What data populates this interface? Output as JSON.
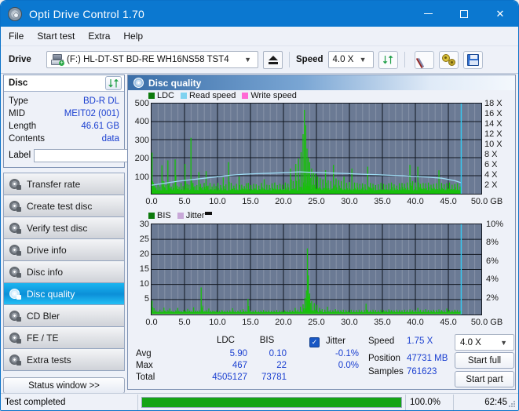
{
  "window": {
    "title": "Opti Drive Control 1.70",
    "icon": "disc-icon",
    "minimize": "–",
    "maximize": "□",
    "close": "✕"
  },
  "menu": {
    "items": [
      "File",
      "Start test",
      "Extra",
      "Help"
    ]
  },
  "toolbar": {
    "drive_label": "Drive",
    "drive_value": "(F:)  HL-DT-ST BD-RE  WH16NS58 TST4",
    "eject_title": "Eject",
    "speed_label": "Speed",
    "speed_value": "4.0 X",
    "refresh_icon": "refresh-icon",
    "erase_icon": "eraser-icon",
    "settings_icon": "gears-icon",
    "save_icon": "save-icon"
  },
  "disc_panel": {
    "title": "Disc",
    "refresh_icon": "refresh-icon",
    "rows": [
      {
        "key": "Type",
        "value": "BD-R DL"
      },
      {
        "key": "MID",
        "value": "MEIT02 (001)"
      },
      {
        "key": "Length",
        "value": "46.61 GB"
      },
      {
        "key": "Contents",
        "value": "data"
      }
    ],
    "label_key": "Label",
    "label_value": "",
    "label_button_icon": "cd-icon"
  },
  "nav": {
    "items": [
      {
        "label": "Transfer rate",
        "icon": "disc-icon",
        "active": false
      },
      {
        "label": "Create test disc",
        "icon": "disc-icon",
        "active": false
      },
      {
        "label": "Verify test disc",
        "icon": "disc-icon",
        "active": false
      },
      {
        "label": "Drive info",
        "icon": "disc-icon",
        "active": false
      },
      {
        "label": "Disc info",
        "icon": "disc-icon",
        "active": false
      },
      {
        "label": "Disc quality",
        "icon": "disc-icon",
        "active": true
      },
      {
        "label": "CD Bler",
        "icon": "disc-icon",
        "active": false
      },
      {
        "label": "FE / TE",
        "icon": "disc-icon",
        "active": false
      },
      {
        "label": "Extra tests",
        "icon": "disc-icon",
        "active": false
      }
    ],
    "status_window": "Status window >>"
  },
  "panel": {
    "title": "Disc quality",
    "icon": "disc-icon"
  },
  "stats": {
    "col_ldc": "LDC",
    "col_bis": "BIS",
    "rows": [
      {
        "label": "Avg",
        "ldc": "5.90",
        "bis": "0.10"
      },
      {
        "label": "Max",
        "ldc": "467",
        "bis": "22"
      },
      {
        "label": "Total",
        "ldc": "4505127",
        "bis": "73781"
      }
    ],
    "jitter_checked": true,
    "jitter_label": "Jitter",
    "jitter_avg": "-0.1%",
    "jitter_max": "0.0%",
    "speed_label": "Speed",
    "speed_value": "1.75 X",
    "position_label": "Position",
    "position_value": "47731 MB",
    "samples_label": "Samples",
    "samples_value": "761623",
    "speed_select": "4.0 X",
    "start_full": "Start full",
    "start_part": "Start part"
  },
  "statusbar": {
    "message": "Test completed",
    "progress_percent": 100.0,
    "progress_text": "100.0%",
    "elapsed": "62:45"
  },
  "colors": {
    "accent": "#0b78d0",
    "ldc_green": "#18c00c",
    "read_speed": "#7fd2f0",
    "write_speed": "#ff6ad5",
    "jitter": "#c8a8d8",
    "plot_bg": "#6b7a94",
    "value_blue": "#1a3fd0",
    "progress_green": "#16a416"
  },
  "chart_data": [
    {
      "id": "ldc-chart",
      "type": "area",
      "title": "",
      "xlabel": "GB",
      "ylabel": "LDC",
      "y2label": "X",
      "xlim": [
        0.0,
        50.0
      ],
      "ylim": [
        0,
        500
      ],
      "y2lim": [
        0,
        18
      ],
      "xticks": [
        0.0,
        5.0,
        10.0,
        15.0,
        20.0,
        25.0,
        30.0,
        35.0,
        40.0,
        45.0,
        50.0
      ],
      "xticklabels": [
        "0.0",
        "5.0",
        "10.0",
        "15.0",
        "20.0",
        "25.0",
        "30.0",
        "35.0",
        "40.0",
        "45.0",
        "50.0 GB"
      ],
      "yticks": [
        100,
        200,
        300,
        400,
        500
      ],
      "y2ticks": [
        2,
        4,
        6,
        8,
        10,
        12,
        14,
        16,
        18
      ],
      "y2ticklabels": [
        "2 X",
        "4 X",
        "6 X",
        "8 X",
        "10 X",
        "12 X",
        "14 X",
        "16 X",
        "18 X"
      ],
      "grid": true,
      "legend": [
        {
          "name": "LDC",
          "color": "#18c00c"
        },
        {
          "name": "Read speed",
          "color": "#7fd2f0"
        },
        {
          "name": "Write speed",
          "color": "#ff6ad5"
        }
      ],
      "legend_position": "top-left",
      "data_end_x": 46.9,
      "cursor_x": 46.95,
      "series": [
        {
          "name": "LDC",
          "kind": "spikes",
          "color": "#18c00c",
          "baseline": 18,
          "x": [
            0.0,
            0.2,
            0.4,
            0.6,
            0.9,
            1.2,
            1.5,
            1.8,
            2.1,
            2.4,
            2.6,
            2.9,
            3.2,
            3.5,
            3.8,
            4.1,
            4.4,
            4.7,
            5.0,
            5.3,
            5.6,
            5.9,
            6.2,
            6.5,
            6.8,
            7.1,
            7.35,
            7.6,
            7.9,
            8.2,
            8.5,
            8.8,
            9.1,
            9.4,
            9.7,
            10.0,
            10.4,
            10.8,
            11.2,
            11.6,
            12.0,
            12.4,
            12.8,
            13.2,
            13.6,
            14.0,
            14.3,
            14.6,
            15.0,
            15.4,
            15.8,
            16.2,
            16.6,
            17.0,
            17.4,
            17.8,
            18.2,
            18.6,
            19.0,
            19.4,
            19.8,
            20.2,
            20.6,
            21.0,
            21.4,
            21.8,
            22.2,
            22.6,
            22.9,
            23.1,
            23.3,
            23.5,
            23.7,
            23.9,
            24.2,
            24.5,
            24.8,
            25.1,
            25.5,
            25.9,
            26.3,
            26.7,
            27.1,
            27.5,
            27.9,
            28.3,
            28.7,
            29.1,
            29.5,
            29.9,
            30.3,
            30.7,
            31.1,
            31.5,
            31.9,
            32.3,
            32.7,
            33.1,
            33.5,
            33.9,
            34.3,
            34.7,
            35.1,
            35.5,
            35.9,
            36.3,
            36.7,
            37.1,
            37.5,
            37.9,
            38.3,
            38.7,
            39.1,
            39.5,
            39.9,
            40.3,
            40.7,
            41.1,
            41.5,
            41.9,
            42.3,
            42.7,
            43.1,
            43.5,
            43.9,
            44.3,
            44.7,
            45.1,
            45.5,
            45.9,
            46.3,
            46.7,
            46.9
          ],
          "y": [
            228,
            60,
            45,
            35,
            52,
            40,
            158,
            70,
            48,
            185,
            60,
            40,
            55,
            190,
            45,
            38,
            60,
            42,
            165,
            55,
            50,
            310,
            60,
            42,
            48,
            120,
            55,
            38,
            60,
            125,
            45,
            60,
            40,
            55,
            42,
            60,
            48,
            90,
            52,
            175,
            60,
            45,
            55,
            95,
            50,
            42,
            58,
            60,
            48,
            55,
            52,
            45,
            60,
            80,
            50,
            48,
            58,
            62,
            48,
            55,
            50,
            62,
            55,
            140,
            70,
            165,
            195,
            230,
            330,
            465,
            380,
            250,
            200,
            175,
            140,
            120,
            110,
            95,
            88,
            80,
            130,
            75,
            70,
            160,
            85,
            75,
            70,
            95,
            60,
            65,
            140,
            62,
            60,
            55,
            58,
            52,
            150,
            60,
            55,
            48,
            52,
            60,
            55,
            50,
            58,
            62,
            52,
            45,
            58,
            60,
            55,
            62,
            160,
            70,
            62,
            150,
            55,
            60,
            58,
            62,
            50,
            55,
            58,
            130,
            60,
            52,
            58,
            62,
            50,
            55,
            58,
            40
          ]
        },
        {
          "name": "Read speed",
          "kind": "line",
          "color": "#9fdcf5",
          "x": [
            0.0,
            2.0,
            4.0,
            6.0,
            8.0,
            10.0,
            12.0,
            14.0,
            16.0,
            18.0,
            20.0,
            21.5,
            22.5,
            23.5,
            24.5,
            26.0,
            28.0,
            30.0,
            32.0,
            34.0,
            36.0,
            38.0,
            40.0,
            42.0,
            44.0,
            46.0,
            46.9
          ],
          "y": [
            1.7,
            2.1,
            2.5,
            2.8,
            3.1,
            3.4,
            3.7,
            3.9,
            4.0,
            4.1,
            4.2,
            4.3,
            4.35,
            4.3,
            4.25,
            4.2,
            4.1,
            4.0,
            3.9,
            3.8,
            3.7,
            3.6,
            3.45,
            3.3,
            3.1,
            2.6,
            2.2
          ],
          "axis": "y2"
        }
      ]
    },
    {
      "id": "bis-chart",
      "type": "area",
      "title": "",
      "xlabel": "GB",
      "ylabel": "BIS",
      "y2label": "%",
      "xlim": [
        0.0,
        50.0
      ],
      "ylim": [
        0,
        30
      ],
      "y2lim": [
        0,
        10
      ],
      "xticks": [
        0.0,
        5.0,
        10.0,
        15.0,
        20.0,
        25.0,
        30.0,
        35.0,
        40.0,
        45.0,
        50.0
      ],
      "xticklabels": [
        "0.0",
        "5.0",
        "10.0",
        "15.0",
        "20.0",
        "25.0",
        "30.0",
        "35.0",
        "40.0",
        "45.0",
        "50.0 GB"
      ],
      "yticks": [
        5,
        10,
        15,
        20,
        25,
        30
      ],
      "y2ticks": [
        2,
        4,
        6,
        8,
        10
      ],
      "y2ticklabels": [
        "2%",
        "4%",
        "6%",
        "8%",
        "10%"
      ],
      "grid": true,
      "legend": [
        {
          "name": "BIS",
          "color": "#18c00c"
        },
        {
          "name": "Jitter",
          "color": "#c8a8d8"
        }
      ],
      "legend_position": "top-left",
      "data_end_x": 46.9,
      "cursor_x": 46.95,
      "series": [
        {
          "name": "BIS",
          "kind": "spikes",
          "color": "#18c00c",
          "baseline": 0.7,
          "x": [
            0.0,
            0.3,
            0.6,
            0.9,
            1.2,
            1.5,
            1.8,
            2.1,
            2.4,
            2.7,
            3.0,
            3.3,
            3.6,
            3.9,
            4.2,
            4.5,
            4.8,
            5.1,
            5.4,
            5.7,
            6.0,
            6.3,
            6.6,
            6.9,
            7.2,
            7.45,
            7.7,
            8.0,
            8.3,
            8.6,
            8.9,
            9.2,
            9.5,
            9.8,
            10.2,
            10.6,
            11.0,
            11.4,
            11.8,
            12.2,
            12.6,
            13.0,
            13.4,
            13.8,
            14.2,
            14.55,
            14.9,
            15.3,
            15.7,
            16.1,
            16.5,
            16.9,
            17.3,
            17.7,
            18.1,
            18.5,
            18.9,
            19.3,
            19.7,
            20.1,
            20.5,
            20.9,
            21.3,
            21.7,
            22.1,
            22.5,
            22.9,
            23.2,
            23.4,
            23.55,
            23.7,
            23.9,
            24.2,
            24.6,
            25.0,
            25.4,
            25.8,
            26.2,
            26.6,
            27.0,
            27.4,
            27.8,
            28.2,
            28.6,
            29.0,
            29.4,
            29.8,
            30.2,
            30.6,
            31.0,
            31.4,
            31.8,
            32.2,
            32.45,
            32.7,
            33.1,
            33.5,
            33.9,
            34.3,
            34.7,
            35.1,
            35.5,
            35.9,
            36.3,
            36.7,
            37.1,
            37.5,
            37.9,
            38.3,
            38.7,
            39.1,
            39.5,
            39.9,
            40.3,
            40.7,
            41.1,
            41.5,
            41.9,
            42.3,
            42.7,
            43.1,
            43.5,
            43.9,
            44.3,
            44.7,
            45.1,
            45.5,
            45.9,
            46.3,
            46.7,
            46.9
          ],
          "y": [
            4.6,
            2.1,
            1.4,
            1.1,
            1.6,
            1.2,
            2.3,
            1.3,
            1.5,
            2.0,
            1.2,
            1.1,
            1.4,
            2.2,
            1.2,
            1.1,
            1.5,
            1.2,
            1.9,
            1.3,
            1.2,
            2.4,
            1.3,
            1.2,
            1.4,
            9.0,
            1.3,
            1.2,
            1.5,
            2.0,
            1.2,
            1.3,
            1.1,
            1.4,
            1.2,
            1.5,
            1.2,
            1.3,
            1.4,
            2.1,
            1.2,
            1.3,
            1.5,
            1.8,
            1.2,
            5.2,
            1.3,
            1.2,
            1.4,
            1.2,
            1.3,
            1.5,
            1.2,
            1.4,
            1.2,
            1.3,
            1.5,
            1.3,
            1.2,
            1.4,
            1.3,
            1.5,
            1.3,
            2.2,
            1.6,
            2.6,
            3.4,
            5.5,
            8.0,
            22.0,
            13.0,
            7.0,
            4.5,
            3.8,
            3.2,
            2.2,
            1.8,
            1.6,
            2.6,
            1.5,
            1.4,
            1.8,
            1.5,
            1.4,
            1.6,
            1.5,
            1.4,
            1.6,
            1.4,
            1.5,
            1.6,
            1.4,
            1.5,
            3.6,
            1.5,
            1.4,
            1.6,
            1.5,
            1.4,
            1.6,
            1.5,
            1.4,
            1.7,
            1.5,
            1.4,
            1.6,
            1.5,
            1.4,
            1.6,
            1.5,
            1.7,
            1.5,
            1.4,
            2.2,
            1.6,
            1.5,
            1.8,
            1.5,
            1.4,
            1.6,
            1.5,
            1.7,
            1.5,
            1.4,
            2.0,
            1.5,
            1.4,
            1.6,
            1.5,
            1.3,
            1.2
          ]
        },
        {
          "name": "Jitter",
          "kind": "line",
          "color": "#c8a8d8",
          "x": [
            0.0,
            46.9
          ],
          "y": [
            0.0,
            0.0
          ],
          "axis": "y2"
        }
      ]
    }
  ]
}
